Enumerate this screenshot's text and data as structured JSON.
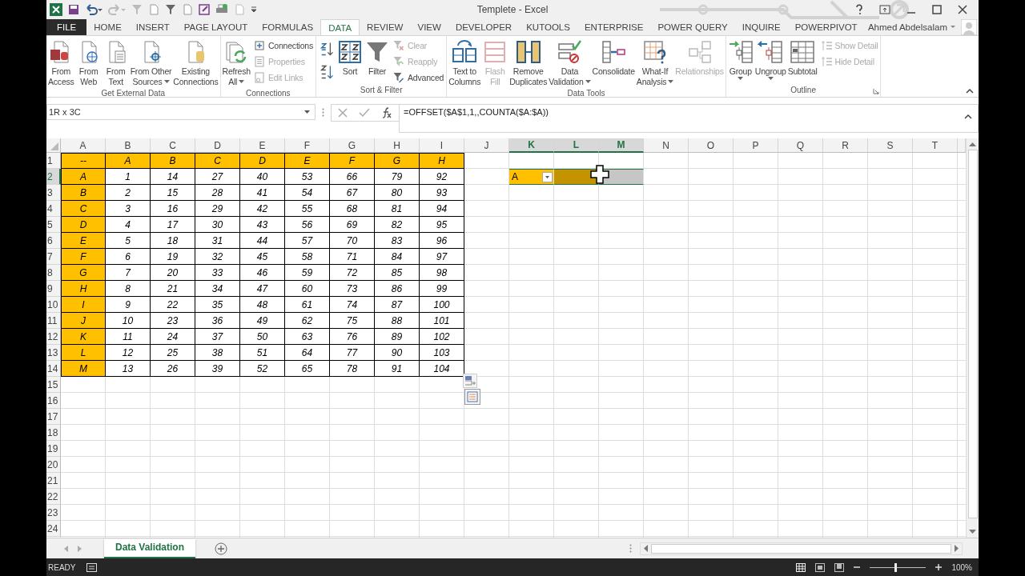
{
  "window": {
    "title": "Templete - Excel",
    "user": "Ahmed Abdelsalam"
  },
  "tabs": [
    {
      "label": "FILE",
      "kind": "file",
      "selected": false
    },
    {
      "label": "HOME",
      "kind": "tab",
      "selected": false
    },
    {
      "label": "INSERT",
      "kind": "tab",
      "selected": false
    },
    {
      "label": "PAGE LAYOUT",
      "kind": "tab",
      "selected": false
    },
    {
      "label": "FORMULAS",
      "kind": "tab",
      "selected": false
    },
    {
      "label": "DATA",
      "kind": "tab",
      "selected": true
    },
    {
      "label": "REVIEW",
      "kind": "tab",
      "selected": false
    },
    {
      "label": "VIEW",
      "kind": "tab",
      "selected": false
    },
    {
      "label": "DEVELOPER",
      "kind": "tab",
      "selected": false
    },
    {
      "label": "KUTOOLS",
      "kind": "tab",
      "selected": false
    },
    {
      "label": "ENTERPRISE",
      "kind": "tab",
      "selected": false
    },
    {
      "label": "POWER QUERY",
      "kind": "tab",
      "selected": false
    },
    {
      "label": "INQUIRE",
      "kind": "tab",
      "selected": false
    },
    {
      "label": "POWERPIVOT",
      "kind": "tab",
      "selected": false
    }
  ],
  "ribbon": {
    "groups": [
      {
        "label": "Get External Data",
        "items": [
          {
            "kind": "large",
            "lines": [
              "From",
              "Access"
            ],
            "dropdown": false,
            "disabled": false
          },
          {
            "kind": "large",
            "lines": [
              "From",
              "Web"
            ],
            "dropdown": false,
            "disabled": false
          },
          {
            "kind": "large",
            "lines": [
              "From",
              "Text"
            ],
            "dropdown": false,
            "disabled": false
          },
          {
            "kind": "large",
            "lines": [
              "From Other",
              "Sources"
            ],
            "dropdown": true,
            "disabled": false
          },
          {
            "kind": "large",
            "lines": [
              "Existing",
              "Connections"
            ],
            "dropdown": false,
            "disabled": false
          }
        ]
      },
      {
        "label": "Connections",
        "items": [
          {
            "kind": "large",
            "lines": [
              "Refresh",
              "All"
            ],
            "dropdown": true,
            "disabled": false
          },
          {
            "kind": "stack",
            "items": [
              {
                "kind": "small",
                "label": "Connections",
                "disabled": false
              },
              {
                "kind": "small",
                "label": "Properties",
                "disabled": true
              },
              {
                "kind": "small",
                "label": "Edit Links",
                "disabled": true
              }
            ]
          }
        ]
      },
      {
        "label": "Sort & Filter",
        "items": [
          {
            "kind": "stack",
            "items": [
              {
                "kind": "icon"
              },
              {
                "kind": "icon"
              }
            ]
          },
          {
            "kind": "large",
            "lines": [
              "Sort"
            ],
            "dropdown": false,
            "disabled": false
          },
          {
            "kind": "large",
            "lines": [
              "Filter"
            ],
            "dropdown": false,
            "disabled": false
          },
          {
            "kind": "stack",
            "items": [
              {
                "kind": "small",
                "label": "Clear",
                "disabled": true
              },
              {
                "kind": "small",
                "label": "Reapply",
                "disabled": true
              },
              {
                "kind": "small",
                "label": "Advanced",
                "disabled": false
              }
            ]
          }
        ]
      },
      {
        "label": "Data Tools",
        "items": [
          {
            "kind": "large",
            "lines": [
              "Text to",
              "Columns"
            ],
            "dropdown": false,
            "disabled": false
          },
          {
            "kind": "large",
            "lines": [
              "Flash",
              "Fill"
            ],
            "dropdown": false,
            "disabled": true
          },
          {
            "kind": "large",
            "lines": [
              "Remove",
              "Duplicates"
            ],
            "dropdown": false,
            "disabled": false
          },
          {
            "kind": "large",
            "lines": [
              "Data",
              "Validation"
            ],
            "dropdown": true,
            "disabled": false
          },
          {
            "kind": "large",
            "lines": [
              "Consolidate"
            ],
            "dropdown": false,
            "disabled": false
          },
          {
            "kind": "large",
            "lines": [
              "What-If",
              "Analysis"
            ],
            "dropdown": true,
            "disabled": false
          },
          {
            "kind": "large",
            "lines": [
              "Relationships"
            ],
            "dropdown": false,
            "disabled": true
          }
        ]
      },
      {
        "label": "Outline",
        "launcher": true,
        "items": [
          {
            "kind": "large",
            "lines": [
              "Group"
            ],
            "dropdown": true,
            "disabled": false
          },
          {
            "kind": "large",
            "lines": [
              "Ungroup"
            ],
            "dropdown": true,
            "disabled": false
          },
          {
            "kind": "large",
            "lines": [
              "Subtotal"
            ],
            "dropdown": false,
            "disabled": false
          },
          {
            "kind": "stack",
            "items": [
              {
                "kind": "small",
                "label": "Show Detail",
                "disabled": true
              },
              {
                "kind": "small",
                "label": "Hide Detail",
                "disabled": true
              }
            ]
          }
        ]
      }
    ]
  },
  "formula_bar": {
    "name_box": "1R x 3C",
    "formula": "=OFFSET($A$1,1,,COUNTA($A:$A))"
  },
  "columns": [
    {
      "label": "A",
      "selected": false
    },
    {
      "label": "B",
      "selected": false
    },
    {
      "label": "C",
      "selected": false
    },
    {
      "label": "D",
      "selected": false
    },
    {
      "label": "E",
      "selected": false
    },
    {
      "label": "F",
      "selected": false
    },
    {
      "label": "G",
      "selected": false
    },
    {
      "label": "H",
      "selected": false
    },
    {
      "label": "I",
      "selected": false
    },
    {
      "label": "J",
      "selected": false
    },
    {
      "label": "K",
      "selected": true
    },
    {
      "label": "L",
      "selected": true
    },
    {
      "label": "M",
      "selected": true
    },
    {
      "label": "N",
      "selected": false
    },
    {
      "label": "O",
      "selected": false
    },
    {
      "label": "P",
      "selected": false
    },
    {
      "label": "Q",
      "selected": false
    },
    {
      "label": "R",
      "selected": false
    },
    {
      "label": "S",
      "selected": false
    },
    {
      "label": "T",
      "selected": false
    }
  ],
  "rows": [
    {
      "label": "1",
      "selected": false,
      "cells": [
        "--",
        "A",
        "B",
        "C",
        "D",
        "E",
        "F",
        "G",
        "H"
      ]
    },
    {
      "label": "2",
      "selected": true,
      "cells": [
        "A",
        "1",
        "14",
        "27",
        "40",
        "53",
        "66",
        "79",
        "92"
      ],
      "side_cells": [
        {
          "value": "A",
          "dropdown": true,
          "filled": true
        },
        {
          "dropdown": false,
          "filled": true
        },
        {
          "dropdown": false,
          "filled": false
        }
      ]
    },
    {
      "label": "3",
      "selected": false,
      "cells": [
        "B",
        "2",
        "15",
        "28",
        "41",
        "54",
        "67",
        "80",
        "93"
      ]
    },
    {
      "label": "4",
      "selected": false,
      "cells": [
        "C",
        "3",
        "16",
        "29",
        "42",
        "55",
        "68",
        "81",
        "94"
      ]
    },
    {
      "label": "5",
      "selected": false,
      "cells": [
        "D",
        "4",
        "17",
        "30",
        "43",
        "56",
        "69",
        "82",
        "95"
      ]
    },
    {
      "label": "6",
      "selected": false,
      "cells": [
        "E",
        "5",
        "18",
        "31",
        "44",
        "57",
        "70",
        "83",
        "96"
      ]
    },
    {
      "label": "7",
      "selected": false,
      "cells": [
        "F",
        "6",
        "19",
        "32",
        "45",
        "58",
        "71",
        "84",
        "97"
      ]
    },
    {
      "label": "8",
      "selected": false,
      "cells": [
        "G",
        "7",
        "20",
        "33",
        "46",
        "59",
        "72",
        "85",
        "98"
      ]
    },
    {
      "label": "9",
      "selected": false,
      "cells": [
        "H",
        "8",
        "21",
        "34",
        "47",
        "60",
        "73",
        "86",
        "99"
      ]
    },
    {
      "label": "10",
      "selected": false,
      "cells": [
        "I",
        "9",
        "22",
        "35",
        "48",
        "61",
        "74",
        "87",
        "100"
      ]
    },
    {
      "label": "11",
      "selected": false,
      "cells": [
        "J",
        "10",
        "23",
        "36",
        "49",
        "62",
        "75",
        "88",
        "101"
      ]
    },
    {
      "label": "12",
      "selected": false,
      "cells": [
        "K",
        "11",
        "24",
        "37",
        "50",
        "63",
        "76",
        "89",
        "102"
      ]
    },
    {
      "label": "13",
      "selected": false,
      "cells": [
        "L",
        "12",
        "25",
        "38",
        "51",
        "64",
        "77",
        "90",
        "103"
      ]
    },
    {
      "label": "14",
      "selected": false,
      "cells": [
        "M",
        "13",
        "26",
        "39",
        "52",
        "65",
        "78",
        "91",
        "104"
      ]
    },
    {
      "label": "15",
      "selected": false
    },
    {
      "label": "16",
      "selected": false
    },
    {
      "label": "17",
      "selected": false
    },
    {
      "label": "18",
      "selected": false
    },
    {
      "label": "19",
      "selected": false
    },
    {
      "label": "20",
      "selected": false
    },
    {
      "label": "21",
      "selected": false
    },
    {
      "label": "22",
      "selected": false
    },
    {
      "label": "23",
      "selected": false
    },
    {
      "label": "24",
      "selected": false
    }
  ],
  "sheet_tabs": [
    {
      "label": "Data Validation",
      "selected": true
    }
  ],
  "status_bar": {
    "status": "READY",
    "zoom": "100%",
    "zoom_level": {
      "level": 0.45
    }
  }
}
